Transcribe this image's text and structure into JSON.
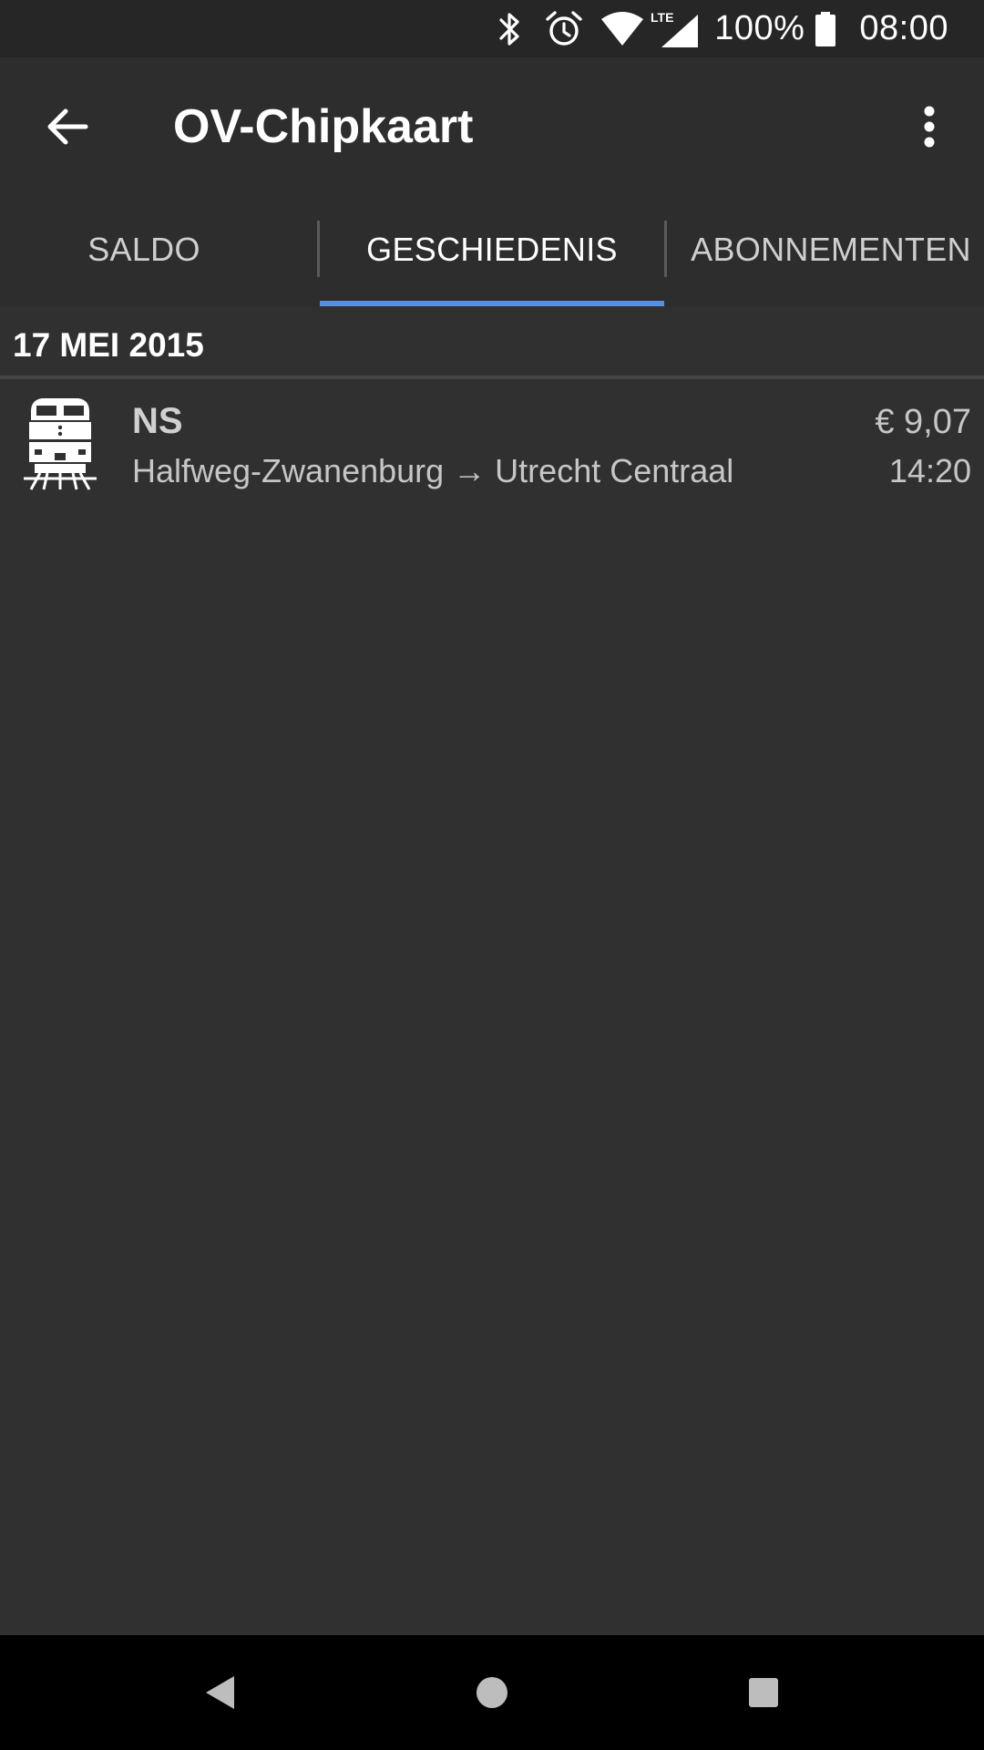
{
  "status_bar": {
    "battery": "100%",
    "time": "08:00",
    "network": "LTE",
    "icons": [
      "bluetooth-icon",
      "alarm-icon",
      "wifi-icon",
      "signal-icon",
      "battery-icon"
    ]
  },
  "app_bar": {
    "title": "OV-Chipkaart",
    "icons": [
      "arrow-back-icon",
      "more-vert-icon"
    ]
  },
  "tabs": [
    {
      "label": "SALDO",
      "active": false
    },
    {
      "label": "GESCHIEDENIS",
      "active": true
    },
    {
      "label": "ABONNEMENTEN",
      "active": false
    }
  ],
  "colors": {
    "background": "#303030",
    "app_bar": "#2d2d2d",
    "accent": "#5a8ee0",
    "status_bar": "#262626",
    "nav_bar": "#000000"
  },
  "history": {
    "date": "17 MEI 2015",
    "trips": [
      {
        "icon": "train-icon",
        "operator": "NS",
        "route": "Halfweg-Zwanenburg → Utrecht Centraal",
        "amount": "€ 9,07",
        "time": "14:20"
      }
    ]
  },
  "nav_bar": {
    "icons": [
      "nav-back-icon",
      "nav-home-icon",
      "nav-recents-icon"
    ]
  }
}
